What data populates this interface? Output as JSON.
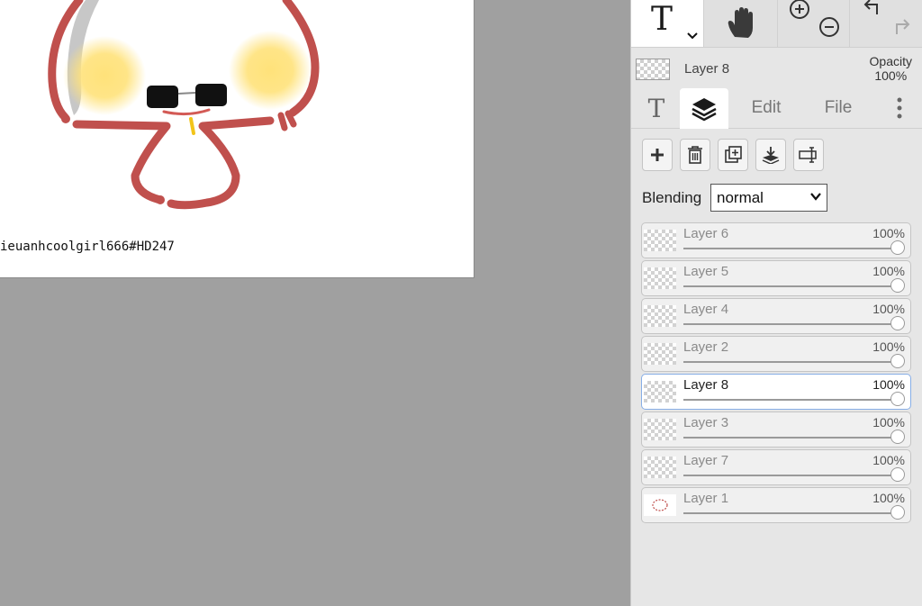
{
  "canvas": {
    "caption": "ieuanhcoolgirl666#HD247"
  },
  "toolbar": {
    "text_tool_icon": "text-tool-icon",
    "hand_tool_icon": "hand-icon",
    "zoom_in_icon": "zoom-in-icon",
    "zoom_out_icon": "zoom-out-icon",
    "undo_icon": "undo-icon",
    "redo_icon": "redo-icon"
  },
  "active_layer": {
    "name": "Layer 8",
    "opacity_label": "Opacity",
    "opacity_value": "100%"
  },
  "tabs": [
    {
      "label": "T",
      "icon": "text-tab-icon"
    },
    {
      "label": "",
      "icon": "layers-icon"
    },
    {
      "label": "Edit"
    },
    {
      "label": "File"
    },
    {
      "label": "",
      "icon": "more-vertical-icon"
    }
  ],
  "layer_actions": [
    {
      "icon": "add-layer-icon"
    },
    {
      "icon": "delete-layer-icon"
    },
    {
      "icon": "duplicate-layer-icon"
    },
    {
      "icon": "merge-down-icon"
    },
    {
      "icon": "rename-layer-icon"
    }
  ],
  "blending": {
    "label": "Blending",
    "value": "normal"
  },
  "layers": [
    {
      "name": "Layer 6",
      "opacity": "100%",
      "level": 1.0,
      "selected": false
    },
    {
      "name": "Layer 5",
      "opacity": "100%",
      "level": 1.0,
      "selected": false
    },
    {
      "name": "Layer 4",
      "opacity": "100%",
      "level": 1.0,
      "selected": false
    },
    {
      "name": "Layer 2",
      "opacity": "100%",
      "level": 1.0,
      "selected": false
    },
    {
      "name": "Layer 8",
      "opacity": "100%",
      "level": 1.0,
      "selected": true
    },
    {
      "name": "Layer 3",
      "opacity": "100%",
      "level": 1.0,
      "selected": false
    },
    {
      "name": "Layer 7",
      "opacity": "100%",
      "level": 1.0,
      "selected": false
    },
    {
      "name": "Layer 1",
      "opacity": "100%",
      "level": 1.0,
      "selected": false
    }
  ],
  "colors": {
    "panel_bg": "#e6e6e6",
    "workspace_bg": "#a0a0a0",
    "selected_border": "#87aee6",
    "stroke_red": "#c0504d",
    "blush_yellow": "#ffe27a"
  }
}
